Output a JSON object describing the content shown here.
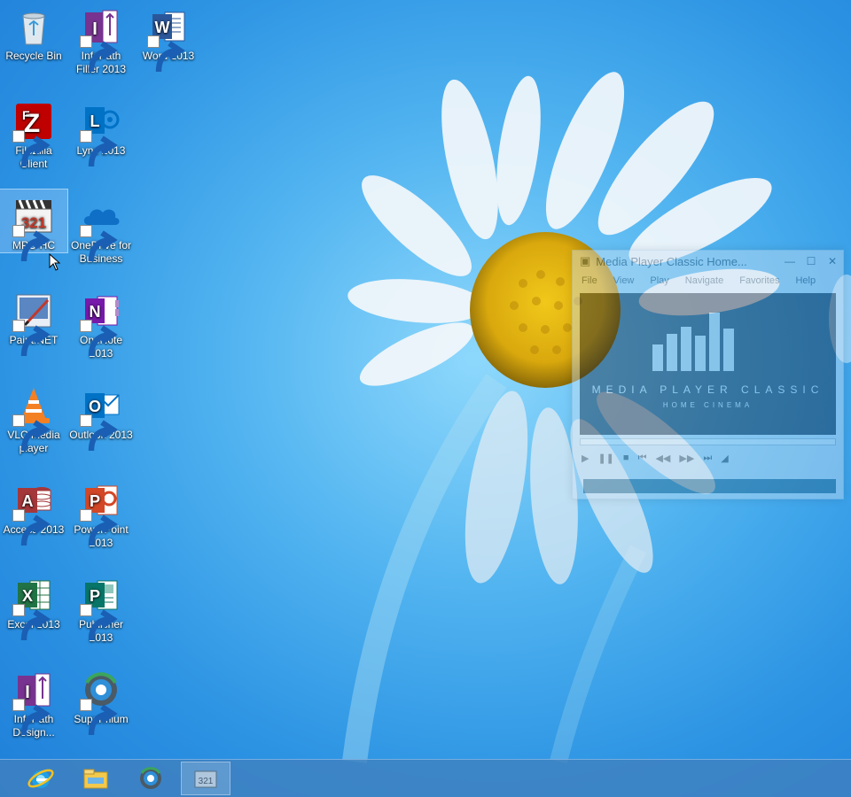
{
  "desktop": {
    "icons": [
      {
        "id": "recycle-bin",
        "label": "Recycle Bin",
        "icon": "recycle-bin-icon"
      },
      {
        "id": "infopath-filler",
        "label": "InfoPath Filler 2013",
        "icon": "infopath-icon"
      },
      {
        "id": "word",
        "label": "Word 2013",
        "icon": "word-icon"
      },
      {
        "id": "filezilla",
        "label": "FileZilla Client",
        "icon": "filezilla-icon"
      },
      {
        "id": "lync",
        "label": "Lync 2013",
        "icon": "lync-icon"
      },
      {
        "id": "mpc-hc",
        "label": "MPC-HC",
        "icon": "mpc-hc-icon"
      },
      {
        "id": "onedrive",
        "label": "OneDrive for Business",
        "icon": "onedrive-icon"
      },
      {
        "id": "paintnet",
        "label": "Paint.NET",
        "icon": "paintnet-icon"
      },
      {
        "id": "onenote",
        "label": "OneNote 2013",
        "icon": "onenote-icon"
      },
      {
        "id": "vlc",
        "label": "VLC media player",
        "icon": "vlc-icon"
      },
      {
        "id": "outlook",
        "label": "Outlook 2013",
        "icon": "outlook-icon"
      },
      {
        "id": "access",
        "label": "Access 2013",
        "icon": "access-icon"
      },
      {
        "id": "powerpoint",
        "label": "PowerPoint 2013",
        "icon": "powerpoint-icon"
      },
      {
        "id": "excel",
        "label": "Excel 2013",
        "icon": "excel-icon"
      },
      {
        "id": "publisher",
        "label": "Publisher 2013",
        "icon": "publisher-icon"
      },
      {
        "id": "infopath-designer",
        "label": "InfoPath Design...",
        "icon": "infopath-icon"
      },
      {
        "id": "supermium",
        "label": "Supermium",
        "icon": "supermium-icon"
      }
    ],
    "selected_icon": "MPC-HC"
  },
  "mpc_window": {
    "title": "Media Player Classic Home...",
    "menu": [
      "File",
      "View",
      "Play",
      "Navigate",
      "Favorites",
      "Help"
    ],
    "logo_text": "MEDIA PLAYER CLASSIC",
    "logo_sub": "HOME CINEMA",
    "state": "fading-in"
  },
  "taskbar": {
    "buttons": [
      {
        "id": "ie",
        "icon": "internet-explorer-icon"
      },
      {
        "id": "explorer",
        "icon": "file-explorer-icon"
      },
      {
        "id": "supermium",
        "icon": "supermium-icon"
      },
      {
        "id": "mpc-hc",
        "icon": "mpc-hc-icon",
        "active": true
      }
    ]
  },
  "colors": {
    "wallpaper_blue": "#2c93e3",
    "taskbar": "#4080be",
    "word": "#2b579a",
    "excel": "#217346",
    "powerpoint": "#d24726",
    "access": "#a4373a",
    "onenote": "#7719aa",
    "outlook": "#0072c6",
    "publisher": "#077568",
    "infopath": "#77338f"
  }
}
